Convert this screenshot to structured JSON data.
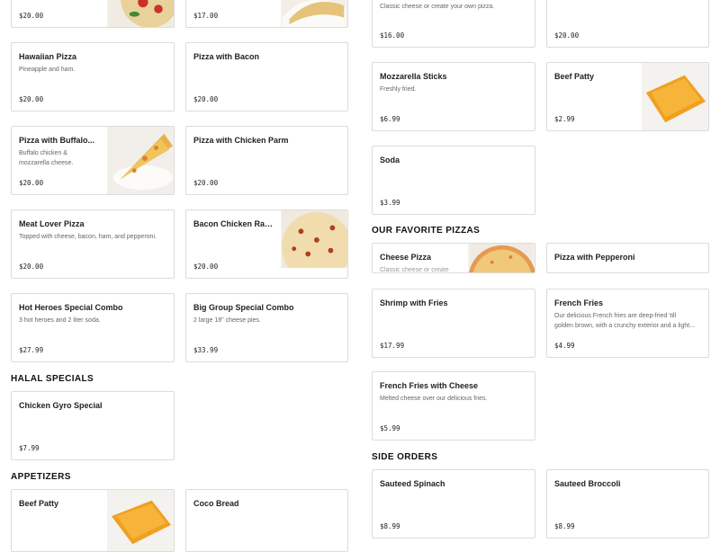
{
  "sections": {
    "halal": "HALAL SPECIALS",
    "appetizers": "APPETIZERS",
    "favorite_pizzas": "OUR FAVORITE PIZZAS",
    "side_orders": "SIDE ORDERS"
  },
  "items": {
    "top_left_1": {
      "price": "$20.00",
      "image": "pizza-margherita-image"
    },
    "top_left_2": {
      "price": "$17.00",
      "image": "calzone-image"
    },
    "top_right_1": {
      "desc": "Classic cheese or create your own pizza.",
      "price": "$16.00"
    },
    "top_right_2": {
      "price": "$20.00"
    },
    "hawaiian": {
      "name": "Hawaiian Pizza",
      "desc": "Pineapple and ham.",
      "price": "$20.00"
    },
    "bacon": {
      "name": "Pizza with Bacon",
      "price": "$20.00"
    },
    "mozz": {
      "name": "Mozzarella Sticks",
      "desc": "Freshly fried.",
      "price": "$6.99"
    },
    "beef_patty_r": {
      "name": "Beef Patty",
      "price": "$2.99",
      "image": "beef-patty-image"
    },
    "buffalo": {
      "name": "Pizza with Buffalo...",
      "desc_line1": "Buffalo chicken &",
      "desc_line2": "mozzarella cheese.",
      "price": "$20.00",
      "image": "buffalo-pizza-slice-image"
    },
    "chicken_parm": {
      "name": "Pizza with Chicken Parm",
      "price": "$20.00"
    },
    "soda": {
      "name": "Soda",
      "price": "$3.99"
    },
    "meat_lover": {
      "name": "Meat Lover Pizza",
      "desc": "Topped with cheese, bacon, ham, and pepperoni.",
      "price": "$20.00"
    },
    "bacon_ranch": {
      "name": "Bacon Chicken Ranch...",
      "price": "$20.00",
      "image": "bacon-ranch-pizza-image"
    },
    "cheese_pizza": {
      "name": "Cheese Pizza",
      "desc": "Classic cheese or create",
      "image": "cheese-pizza-image"
    },
    "pepperoni": {
      "name": "Pizza with Pepperoni"
    },
    "heroes": {
      "name": "Hot Heroes Special Combo",
      "desc": "3 hot heroes and 2 liter soda.",
      "price": "$27.99"
    },
    "big_group": {
      "name": "Big Group Special Combo",
      "desc": "2 large 18\" cheese pies.",
      "price": "$33.99"
    },
    "shrimp": {
      "name": "Shrimp with Fries",
      "price": "$17.99"
    },
    "fries": {
      "name": "French Fries",
      "desc_line1": "Our delicious French fries are deep-fried 'till",
      "desc_line2": "golden brown, with a crunchy exterior and a light...",
      "price": "$4.99"
    },
    "gyro": {
      "name": "Chicken Gyro Special",
      "price": "$7.99"
    },
    "fries_cheese": {
      "name": "French Fries with Cheese",
      "desc": "Melted cheese over our delicious fries.",
      "price": "$5.99"
    },
    "beef_patty_l": {
      "name": "Beef Patty",
      "image": "beef-patty-image"
    },
    "coco": {
      "name": "Coco Bread"
    },
    "spinach": {
      "name": "Sauteed Spinach",
      "price": "$8.99"
    },
    "broccoli": {
      "name": "Sauteed Broccoli",
      "price": "$8.99"
    }
  },
  "colors": {
    "border": "#dcdcdc",
    "text": "#1a1a1a",
    "muted": "#666666"
  }
}
